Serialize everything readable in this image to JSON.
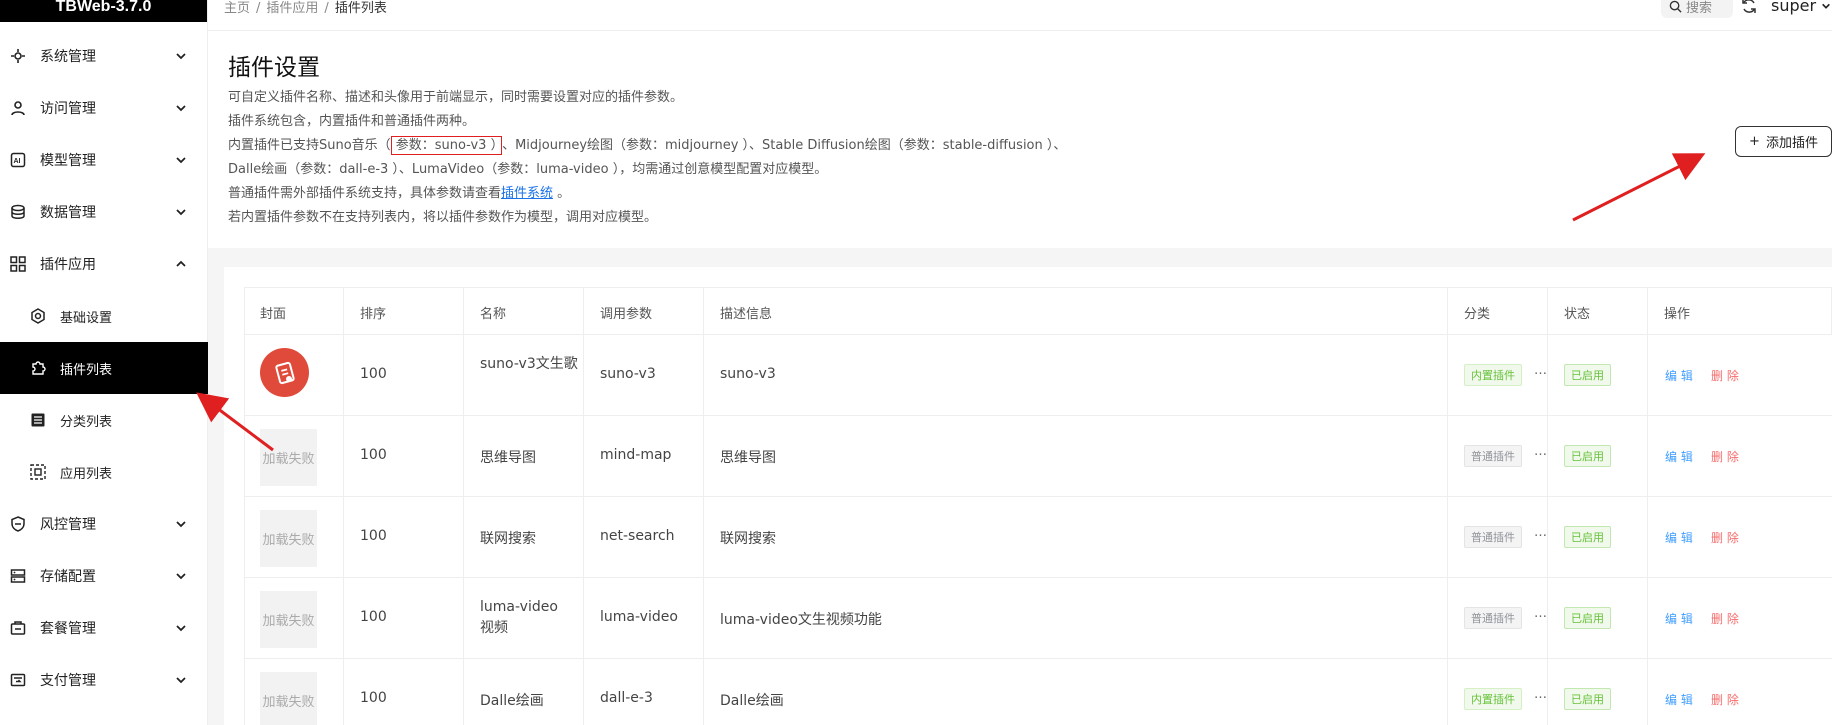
{
  "app": {
    "title": "TBWeb-3.7.0"
  },
  "sidebar": {
    "items": [
      {
        "label": "系统管理",
        "icon": "settings-icon"
      },
      {
        "label": "访问管理",
        "icon": "user-icon"
      },
      {
        "label": "模型管理",
        "icon": "ai-icon"
      },
      {
        "label": "数据管理",
        "icon": "database-icon"
      },
      {
        "label": "插件应用",
        "icon": "apps-icon"
      },
      {
        "label": "风控管理",
        "icon": "shield-icon"
      },
      {
        "label": "存储配置",
        "icon": "storage-icon"
      },
      {
        "label": "套餐管理",
        "icon": "package-icon"
      },
      {
        "label": "支付管理",
        "icon": "payment-icon"
      }
    ],
    "sub_items": [
      {
        "label": "基础设置",
        "icon": "gear-icon"
      },
      {
        "label": "插件列表",
        "icon": "puzzle-icon"
      },
      {
        "label": "分类列表",
        "icon": "list-icon"
      },
      {
        "label": "应用列表",
        "icon": "grid-icon"
      }
    ]
  },
  "header": {
    "breadcrumb": [
      "主页",
      "插件应用",
      "插件列表"
    ],
    "search_label": "搜索",
    "user": "super"
  },
  "intro": {
    "title": "插件设置",
    "lines": [
      "可自定义插件名称、描述和头像用于前端显示，同时需要设置对应的插件参数。",
      "插件系统包含，内置插件和普通插件两种。"
    ],
    "line3_a": "内置插件已支持Suno音乐（",
    "line3_boxed": "参数：suno-v3 ）",
    "line3_b": "、Midjourney绘图（参数：midjourney ）、Stable Diffusion绘图（参数：stable-diffusion ）、",
    "line4": "Dalle绘画（参数：dall-e-3 ）、LumaVideo（参数：luma-video ），均需通过创意模型配置对应模型。",
    "line5_a": "普通插件需外部插件系统支持，具体参数请查看",
    "line5_link": "插件系统",
    "line5_b": " 。",
    "line6": "若内置插件参数不在支持列表内，将以插件参数作为模型，调用对应模型。",
    "add_button": "添加插件"
  },
  "table": {
    "headers": [
      "封面",
      "排序",
      "名称",
      "调用参数",
      "描述信息",
      "分类",
      "状态",
      "操作"
    ],
    "rows": [
      {
        "cover": "",
        "order": "100",
        "name": "suno-v3文生歌",
        "param": "suno-v3",
        "desc": "suno-v3",
        "category": "内置插件",
        "status": "已启用"
      },
      {
        "cover": "加载失败",
        "order": "100",
        "name": "思维导图",
        "param": "mind-map",
        "desc": "思维导图",
        "category": "普通插件",
        "status": "已启用"
      },
      {
        "cover": "加载失败",
        "order": "100",
        "name": "联网搜索",
        "param": "net-search",
        "desc": "联网搜索",
        "category": "普通插件",
        "status": "已启用"
      },
      {
        "cover": "加载失败",
        "order": "100",
        "name": "luma-video视频",
        "param": "luma-video",
        "desc": "luma-video文生视频功能",
        "category": "普通插件",
        "status": "已启用"
      },
      {
        "cover": "加载失败",
        "order": "100",
        "name": "Dalle绘画",
        "param": "dall-e-3",
        "desc": "Dalle绘画",
        "category": "内置插件",
        "status": "已启用"
      }
    ],
    "more_glyph": "…",
    "edit_label": "编 辑",
    "delete_label": "删 除"
  },
  "colors": {
    "accent": "#000000",
    "annotation": "#e02020",
    "enabled": "#67c23a",
    "link": "#409eff",
    "danger": "#f56c6c"
  }
}
